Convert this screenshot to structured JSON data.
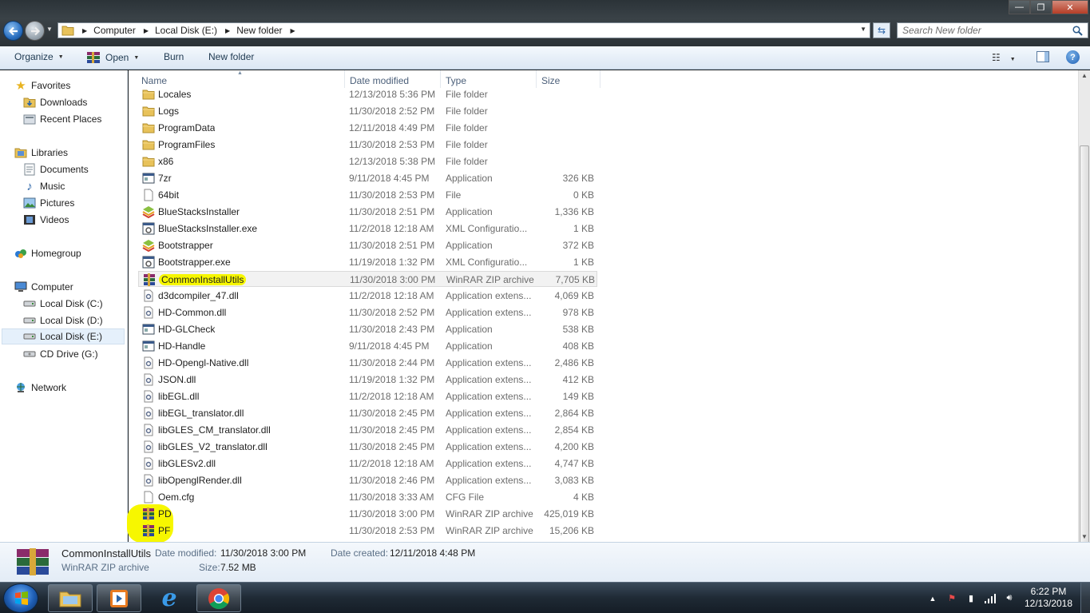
{
  "address": {
    "crumbs": [
      "Computer",
      "Local Disk (E:)",
      "New folder"
    ],
    "search_placeholder": "Search New folder"
  },
  "toolbar": {
    "organize": "Organize",
    "open": "Open",
    "burn": "Burn",
    "new_folder": "New folder"
  },
  "nav": {
    "favorites": "Favorites",
    "downloads": "Downloads",
    "recent_places": "Recent Places",
    "libraries": "Libraries",
    "documents": "Documents",
    "music": "Music",
    "pictures": "Pictures",
    "videos": "Videos",
    "homegroup": "Homegroup",
    "computer": "Computer",
    "disk_c": "Local Disk (C:)",
    "disk_d": "Local Disk (D:)",
    "disk_e": "Local Disk (E:)",
    "cd_drive": "CD Drive (G:)",
    "network": "Network"
  },
  "columns": {
    "name": "Name",
    "date_modified": "Date modified",
    "type": "Type",
    "size": "Size"
  },
  "files": [
    {
      "name": "Locales",
      "date": "12/13/2018 5:36 PM",
      "type": "File folder",
      "size": "",
      "icon": "folder-icon"
    },
    {
      "name": "Logs",
      "date": "11/30/2018 2:52 PM",
      "type": "File folder",
      "size": "",
      "icon": "folder-icon"
    },
    {
      "name": "ProgramData",
      "date": "12/11/2018 4:49 PM",
      "type": "File folder",
      "size": "",
      "icon": "folder-icon"
    },
    {
      "name": "ProgramFiles",
      "date": "11/30/2018 2:53 PM",
      "type": "File folder",
      "size": "",
      "icon": "folder-icon"
    },
    {
      "name": "x86",
      "date": "12/13/2018 5:38 PM",
      "type": "File folder",
      "size": "",
      "icon": "folder-icon"
    },
    {
      "name": "7zr",
      "date": "9/11/2018 4:45 PM",
      "type": "Application",
      "size": "326 KB",
      "icon": "app-icon"
    },
    {
      "name": "64bit",
      "date": "11/30/2018 2:53 PM",
      "type": "File",
      "size": "0 KB",
      "icon": "file-icon"
    },
    {
      "name": "BlueStacksInstaller",
      "date": "11/30/2018 2:51 PM",
      "type": "Application",
      "size": "1,336 KB",
      "icon": "bluestacks-icon"
    },
    {
      "name": "BlueStacksInstaller.exe",
      "date": "11/2/2018 12:18 AM",
      "type": "XML Configuratio...",
      "size": "1 KB",
      "icon": "config-icon"
    },
    {
      "name": "Bootstrapper",
      "date": "11/30/2018 2:51 PM",
      "type": "Application",
      "size": "372 KB",
      "icon": "bluestacks-icon"
    },
    {
      "name": "Bootstrapper.exe",
      "date": "11/19/2018 1:32 PM",
      "type": "XML Configuratio...",
      "size": "1 KB",
      "icon": "config-icon"
    },
    {
      "name": "CommonInstallUtils",
      "date": "11/30/2018 3:00 PM",
      "type": "WinRAR ZIP archive",
      "size": "7,705 KB",
      "icon": "winrar-icon"
    },
    {
      "name": "d3dcompiler_47.dll",
      "date": "11/2/2018 12:18 AM",
      "type": "Application extens...",
      "size": "4,069 KB",
      "icon": "dll-icon"
    },
    {
      "name": "HD-Common.dll",
      "date": "11/30/2018 2:52 PM",
      "type": "Application extens...",
      "size": "978 KB",
      "icon": "dll-icon"
    },
    {
      "name": "HD-GLCheck",
      "date": "11/30/2018 2:43 PM",
      "type": "Application",
      "size": "538 KB",
      "icon": "app-icon"
    },
    {
      "name": "HD-Handle",
      "date": "9/11/2018 4:45 PM",
      "type": "Application",
      "size": "408 KB",
      "icon": "app-icon"
    },
    {
      "name": "HD-Opengl-Native.dll",
      "date": "11/30/2018 2:44 PM",
      "type": "Application extens...",
      "size": "2,486 KB",
      "icon": "dll-icon"
    },
    {
      "name": "JSON.dll",
      "date": "11/19/2018 1:32 PM",
      "type": "Application extens...",
      "size": "412 KB",
      "icon": "dll-icon"
    },
    {
      "name": "libEGL.dll",
      "date": "11/2/2018 12:18 AM",
      "type": "Application extens...",
      "size": "149 KB",
      "icon": "dll-icon"
    },
    {
      "name": "libEGL_translator.dll",
      "date": "11/30/2018 2:45 PM",
      "type": "Application extens...",
      "size": "2,864 KB",
      "icon": "dll-icon"
    },
    {
      "name": "libGLES_CM_translator.dll",
      "date": "11/30/2018 2:45 PM",
      "type": "Application extens...",
      "size": "2,854 KB",
      "icon": "dll-icon"
    },
    {
      "name": "libGLES_V2_translator.dll",
      "date": "11/30/2018 2:45 PM",
      "type": "Application extens...",
      "size": "4,200 KB",
      "icon": "dll-icon"
    },
    {
      "name": "libGLESv2.dll",
      "date": "11/2/2018 12:18 AM",
      "type": "Application extens...",
      "size": "4,747 KB",
      "icon": "dll-icon"
    },
    {
      "name": "libOpenglRender.dll",
      "date": "11/30/2018 2:46 PM",
      "type": "Application extens...",
      "size": "3,083 KB",
      "icon": "dll-icon"
    },
    {
      "name": "Oem.cfg",
      "date": "11/30/2018 3:33 AM",
      "type": "CFG File",
      "size": "4 KB",
      "icon": "file-icon"
    },
    {
      "name": "PD",
      "date": "11/30/2018 3:00 PM",
      "type": "WinRAR ZIP archive",
      "size": "425,019 KB",
      "icon": "winrar-icon"
    },
    {
      "name": "PF",
      "date": "11/30/2018 2:53 PM",
      "type": "WinRAR ZIP archive",
      "size": "15,206 KB",
      "icon": "winrar-icon"
    }
  ],
  "details": {
    "name": "CommonInstallUtils",
    "type": "WinRAR ZIP archive",
    "date_modified_label": "Date modified:",
    "date_modified": "11/30/2018 3:00 PM",
    "date_created_label": "Date created:",
    "date_created": "12/11/2018 4:48 PM",
    "size_label": "Size:",
    "size": "7.52 MB"
  },
  "clock": {
    "time": "6:22 PM",
    "date": "12/13/2018"
  },
  "colors": {
    "highlight": "#f7f700",
    "selection": "#e5f0fb"
  }
}
